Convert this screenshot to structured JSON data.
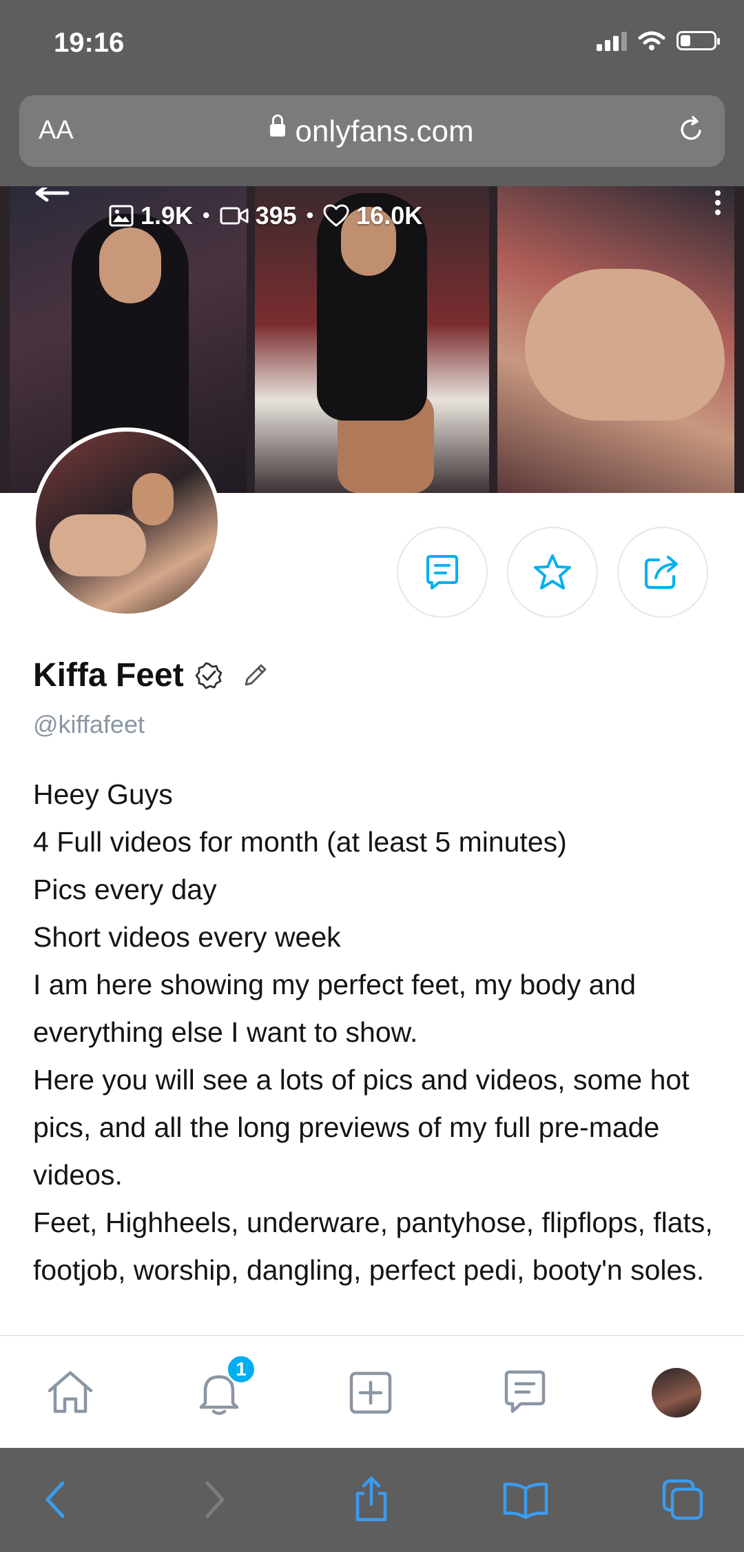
{
  "status": {
    "time": "19:16"
  },
  "browser": {
    "aa_label": "AA",
    "url": "onlyfans.com"
  },
  "cover": {
    "stats": {
      "photos": "1.9K",
      "videos": "395",
      "likes": "16.0K",
      "separator": "•"
    }
  },
  "profile": {
    "name": "Kiffa Feet",
    "username": "@kiffafeet",
    "bio": [
      "Heey Guys",
      "4 Full videos for month (at least 5 minutes)",
      "Pics every day",
      "Short videos every week",
      "I am here showing my perfect feet, my body and everything else I want to show.",
      "Here you will see a lots of pics and videos, some hot pics, and all the long previews of my full pre-made videos.",
      "Feet, Highheels, underware, pantyhose, flipflops, flats, footjob, worship, dangling, perfect pedi, booty'n soles."
    ]
  },
  "tabbar": {
    "notifications_badge": "1"
  },
  "icons": {
    "status": [
      "signal-icon",
      "wifi-icon",
      "battery-icon"
    ],
    "actions": [
      "message-icon",
      "star-icon",
      "share-icon"
    ],
    "tabbar": [
      "home-icon",
      "bell-icon",
      "add-icon",
      "chat-icon",
      "avatar"
    ],
    "safari": [
      "back-icon",
      "forward-icon",
      "share-icon",
      "bookmarks-icon",
      "tabs-icon"
    ]
  },
  "colors": {
    "accent": "#00aff0",
    "username": "#8a96a3",
    "browser_chrome": "#5e5e5e"
  }
}
